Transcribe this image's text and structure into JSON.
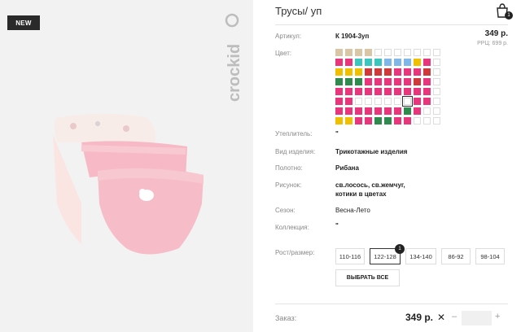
{
  "badge": "NEW",
  "brand": "crockid",
  "product": {
    "title": "Трусы/ уп",
    "article_label": "Артикул:",
    "article": "К 1904-3уп",
    "price": "349 р.",
    "rrc": "РРЦ: 699 р.",
    "color_label": "Цвет:",
    "insulation_label": "Утеплитель:",
    "insulation": "\"",
    "kind_label": "Вид изделия:",
    "kind": "Трикотажные изделия",
    "fabric_label": "Полотно:",
    "fabric": "Рибана",
    "pattern_label": "Рисунок:",
    "pattern_line1": "св.лосось, св.жемчуг,",
    "pattern_line2": "котики в цветах",
    "season_label": "Сезон:",
    "season": "Весна-Лето",
    "collection_label": "Коллекция:",
    "collection": "\""
  },
  "swatches": [
    [
      "#d8c6a6",
      "#d8c6a6",
      "#d8c6a6",
      "#d8c6a6",
      "",
      "",
      "",
      "",
      "",
      "",
      ""
    ],
    [
      "#e8357b",
      "#e8357b",
      "#3cc6c0",
      "#3cc6c0",
      "#3cc6c0",
      "#7fb8e8",
      "#7fb8e8",
      "#7fb8e8",
      "#f0c000",
      "#e8357b",
      ""
    ],
    [
      "#f0c000",
      "#f0c000",
      "#f0c000",
      "#d0393a",
      "#d0393a",
      "#d0393a",
      "#e8357b",
      "#e8357b",
      "#e8357b",
      "#d0393a",
      ""
    ],
    [
      "#2f8a4e",
      "#2f8a4e",
      "#2f8a4e",
      "#e8357b",
      "#e8357b",
      "#e8357b",
      "#e8357b",
      "#e8357b",
      "#d0393a",
      "#e8357b",
      ""
    ],
    [
      "#e8357b",
      "#e8357b",
      "#e8357b",
      "#e8357b",
      "#e8357b",
      "#e8357b",
      "#e8357b",
      "#e8357b",
      "#e8357b",
      "#e8357b",
      ""
    ],
    [
      "#e8357b",
      "#e8357b",
      "",
      "",
      "",
      "",
      "",
      "",
      "#e8357b",
      "#e8357b",
      ""
    ],
    [
      "#e8357b",
      "#e8357b",
      "#e8357b",
      "#e8357b",
      "#e8357b",
      "#e8357b",
      "#e8357b",
      "#2f8a4e",
      "#e8357b",
      "",
      ""
    ],
    [
      "#f0c000",
      "#f0c000",
      "#e8357b",
      "#e8357b",
      "#2f8a4e",
      "#2f8a4e",
      "#e8357b",
      "#e8357b",
      "",
      "",
      ""
    ]
  ],
  "size_label": "Рост/размер:",
  "sizes": [
    "110-116",
    "122-128",
    "134-140",
    "86-92",
    "98-104"
  ],
  "size_badge": "1",
  "select_all": "ВЫБРАТЬ ВСЕ",
  "order": {
    "label": "Заказ:",
    "price": "349 р.",
    "x": "✕",
    "minus": "–",
    "plus": "+"
  },
  "cart_count": "1"
}
